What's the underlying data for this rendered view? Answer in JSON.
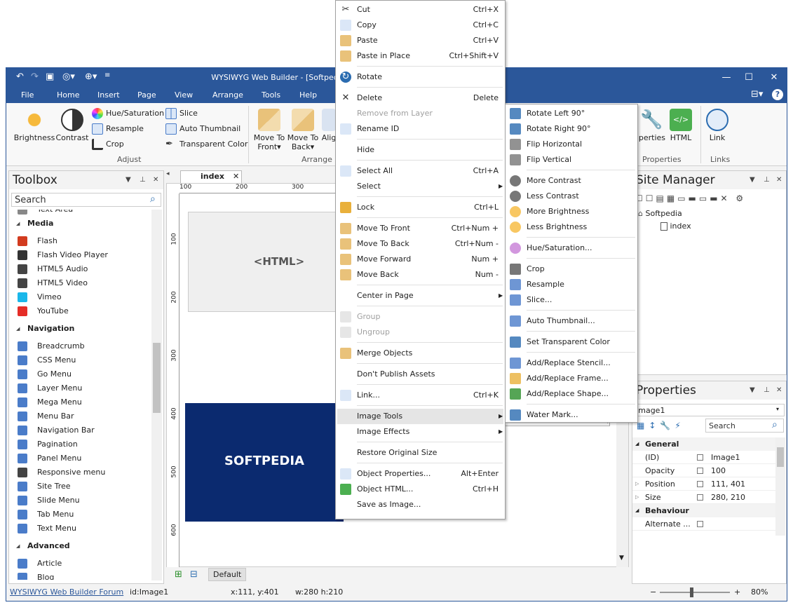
{
  "window": {
    "title": "WYSIWYG Web Builder - [Softpedia]"
  },
  "menubar": {
    "items": [
      "File",
      "Home",
      "Insert",
      "Page",
      "View",
      "Arrange",
      "Tools",
      "Help"
    ]
  },
  "ribbon": {
    "adjust": {
      "brightness": "Brightness",
      "contrast": "Contrast",
      "hue": "Hue/Saturation",
      "resample": "Resample",
      "crop": "Crop",
      "slice": "Slice",
      "auto_thumb": "Auto Thumbnail",
      "transparent": "Transparent Color",
      "label": "Adjust"
    },
    "arrange": {
      "move_front_1": "Move To",
      "move_front_2": "Front",
      "move_back_1": "Move To",
      "move_back_2": "Back",
      "align": "Alig",
      "label": "Arrange"
    },
    "properties": {
      "properties": "perties",
      "html": "HTML",
      "label": "Properties"
    },
    "links": {
      "link": "Link",
      "label": "Links"
    }
  },
  "toolbox": {
    "title": "Toolbox",
    "search_placeholder": "Search",
    "items": [
      {
        "type": "item",
        "label": "Text Area",
        "icon": "textarea-icon",
        "color": "#888888"
      },
      {
        "type": "cat",
        "label": "Media"
      },
      {
        "type": "item",
        "label": "Flash",
        "icon": "flash-icon",
        "color": "#d23b1f"
      },
      {
        "type": "item",
        "label": "Flash Video Player",
        "icon": "video-player-icon",
        "color": "#333333"
      },
      {
        "type": "item",
        "label": "HTML5 Audio",
        "icon": "music-note-icon",
        "color": "#444444"
      },
      {
        "type": "item",
        "label": "HTML5 Video",
        "icon": "film-icon",
        "color": "#444444"
      },
      {
        "type": "item",
        "label": "Vimeo",
        "icon": "vimeo-icon",
        "color": "#1ab7ea"
      },
      {
        "type": "item",
        "label": "YouTube",
        "icon": "youtube-icon",
        "color": "#e52d27"
      },
      {
        "type": "cat",
        "label": "Navigation"
      },
      {
        "type": "item",
        "label": "Breadcrumb",
        "icon": "breadcrumb-icon",
        "color": "#4a7cc9"
      },
      {
        "type": "item",
        "label": "CSS Menu",
        "icon": "css-menu-icon",
        "color": "#4a7cc9"
      },
      {
        "type": "item",
        "label": "Go Menu",
        "icon": "go-menu-icon",
        "color": "#4a7cc9"
      },
      {
        "type": "item",
        "label": "Layer Menu",
        "icon": "layer-menu-icon",
        "color": "#4a7cc9"
      },
      {
        "type": "item",
        "label": "Mega Menu",
        "icon": "mega-menu-icon",
        "color": "#4a7cc9"
      },
      {
        "type": "item",
        "label": "Menu Bar",
        "icon": "menu-bar-icon",
        "color": "#4a7cc9"
      },
      {
        "type": "item",
        "label": "Navigation Bar",
        "icon": "navigation-bar-icon",
        "color": "#4a7cc9"
      },
      {
        "type": "item",
        "label": "Pagination",
        "icon": "pagination-icon",
        "color": "#4a7cc9"
      },
      {
        "type": "item",
        "label": "Panel Menu",
        "icon": "panel-menu-icon",
        "color": "#4a7cc9"
      },
      {
        "type": "item",
        "label": "Responsive menu",
        "icon": "hamburger-icon",
        "color": "#444444"
      },
      {
        "type": "item",
        "label": "Site Tree",
        "icon": "site-tree-icon",
        "color": "#4a7cc9"
      },
      {
        "type": "item",
        "label": "Slide Menu",
        "icon": "slide-menu-icon",
        "color": "#4a7cc9"
      },
      {
        "type": "item",
        "label": "Tab Menu",
        "icon": "tab-menu-icon",
        "color": "#4a7cc9"
      },
      {
        "type": "item",
        "label": "Text Menu",
        "icon": "abc-icon",
        "color": "#4a7cc9"
      },
      {
        "type": "cat",
        "label": "Advanced"
      },
      {
        "type": "item",
        "label": "Article",
        "icon": "article-icon",
        "color": "#4a7cc9"
      },
      {
        "type": "item",
        "label": "Blog",
        "icon": "blog-icon",
        "color": "#4a7cc9"
      }
    ]
  },
  "editor": {
    "tab": "index",
    "ruler": [
      "100",
      "200",
      "300"
    ],
    "vruler": [
      "100",
      "200",
      "300",
      "400",
      "500",
      "600"
    ],
    "html_placeholder": "<HTML>",
    "image_text": "SOFTPEDIA",
    "footer_tab": "Default"
  },
  "context_menu": {
    "items": [
      {
        "label": "Cut",
        "shortcut": "Ctrl+X",
        "icon": "scissors-icon"
      },
      {
        "label": "Copy",
        "shortcut": "Ctrl+C",
        "icon": "copy-icon"
      },
      {
        "label": "Paste",
        "shortcut": "Ctrl+V",
        "icon": "paste-icon"
      },
      {
        "label": "Paste in Place",
        "shortcut": "Ctrl+Shift+V",
        "icon": "paste-in-place-icon"
      },
      {
        "label": "Rotate",
        "shortcut": "",
        "icon": "rotate-icon"
      },
      {
        "label": "Delete",
        "shortcut": "Delete",
        "icon": "delete-x-icon"
      },
      {
        "label": "Remove from Layer",
        "shortcut": "",
        "icon": "",
        "disabled": true
      },
      {
        "label": "Rename ID",
        "shortcut": "",
        "icon": "rename-icon"
      },
      {
        "label": "Hide",
        "shortcut": "",
        "icon": ""
      },
      {
        "label": "Select All",
        "shortcut": "Ctrl+A",
        "icon": "select-all-icon"
      },
      {
        "label": "Select",
        "shortcut": "",
        "icon": "",
        "submenu": true
      },
      {
        "label": "Lock",
        "shortcut": "Ctrl+L",
        "icon": "lock-icon"
      },
      {
        "label": "Move To Front",
        "shortcut": "Ctrl+Num +",
        "icon": "move-front-icon"
      },
      {
        "label": "Move To Back",
        "shortcut": "Ctrl+Num -",
        "icon": "move-back-icon"
      },
      {
        "label": "Move Forward",
        "shortcut": "Num +",
        "icon": "move-forward-icon"
      },
      {
        "label": "Move Back",
        "shortcut": "Num -",
        "icon": "move-back-one-icon"
      },
      {
        "label": "Center in Page",
        "shortcut": "",
        "icon": "",
        "submenu": true
      },
      {
        "label": "Group",
        "shortcut": "",
        "icon": "group-icon",
        "disabled": true
      },
      {
        "label": "Ungroup",
        "shortcut": "",
        "icon": "ungroup-icon",
        "disabled": true
      },
      {
        "label": "Merge Objects",
        "shortcut": "",
        "icon": "merge-icon"
      },
      {
        "label": "Don't Publish Assets",
        "shortcut": "",
        "icon": ""
      },
      {
        "label": "Link...",
        "shortcut": "Ctrl+K",
        "icon": "globe-link-icon"
      },
      {
        "label": "Image Tools",
        "shortcut": "",
        "icon": "",
        "submenu": true,
        "active": true
      },
      {
        "label": "Image Effects",
        "shortcut": "",
        "icon": "",
        "submenu": true
      },
      {
        "label": "Restore Original Size",
        "shortcut": "",
        "icon": ""
      },
      {
        "label": "Object Properties...",
        "shortcut": "Alt+Enter",
        "icon": "properties-icon"
      },
      {
        "label": "Object HTML...",
        "shortcut": "Ctrl+H",
        "icon": "html-icon"
      },
      {
        "label": "Save as Image...",
        "shortcut": "",
        "icon": ""
      }
    ]
  },
  "submenu": {
    "items": [
      {
        "label": "Rotate Left 90°",
        "icon": "rotate-left-icon"
      },
      {
        "label": "Rotate Right 90°",
        "icon": "rotate-right-icon"
      },
      {
        "label": "Flip Horizontal",
        "icon": "flip-horizontal-icon"
      },
      {
        "label": "Flip Vertical",
        "icon": "flip-vertical-icon"
      },
      {
        "label": "More Contrast",
        "icon": "contrast-icon"
      },
      {
        "label": "Less Contrast",
        "icon": "contrast-icon"
      },
      {
        "label": "More Brightness",
        "icon": "sun-icon"
      },
      {
        "label": "Less Brightness",
        "icon": "sun-icon"
      },
      {
        "label": "Hue/Saturation...",
        "icon": "hue-wheel-icon"
      },
      {
        "label": "Crop",
        "icon": "crop-icon"
      },
      {
        "label": "Resample",
        "icon": "resample-icon"
      },
      {
        "label": "Slice...",
        "icon": "slice-icon"
      },
      {
        "label": "Auto Thumbnail...",
        "icon": "thumbnail-icon"
      },
      {
        "label": "Set Transparent Color",
        "icon": "eyedropper-icon"
      },
      {
        "label": "Add/Replace Stencil...",
        "icon": "stencil-icon"
      },
      {
        "label": "Add/Replace Frame...",
        "icon": "frame-icon"
      },
      {
        "label": "Add/Replace Shape...",
        "icon": "shape-icon"
      },
      {
        "label": "Water Mark...",
        "icon": "watermark-icon"
      }
    ]
  },
  "site_manager": {
    "title": "Site Manager",
    "root": "Softpedia",
    "page": "index"
  },
  "properties": {
    "title": "Properties",
    "object": "Image1",
    "search_placeholder": "Search",
    "rows": [
      {
        "type": "cat",
        "label": "General"
      },
      {
        "type": "row",
        "name": "(ID)",
        "value": "Image1"
      },
      {
        "type": "row",
        "name": "Opacity",
        "value": "100"
      },
      {
        "type": "row",
        "name": "Position",
        "value": "111, 401",
        "expand": true
      },
      {
        "type": "row",
        "name": "Size",
        "value": "280, 210",
        "expand": true
      },
      {
        "type": "cat",
        "label": "Behaviour"
      },
      {
        "type": "row",
        "name": "Alternate ...",
        "value": ""
      }
    ]
  },
  "status": {
    "forum": "WYSIWYG Web Builder Forum",
    "id": "id:Image1",
    "coords": "x:111, y:401",
    "size": "w:280 h:210",
    "zoom": "80%"
  },
  "colors": {
    "titlebar": "#2b579a",
    "image_bg": "#0b2a6f",
    "menu_active": "#e5e5e5"
  }
}
